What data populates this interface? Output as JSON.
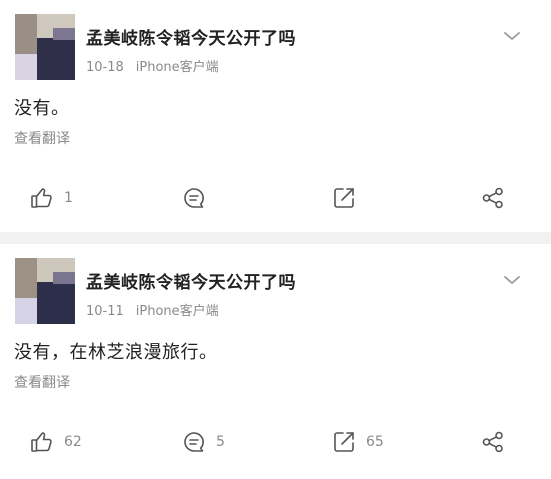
{
  "posts": [
    {
      "author": "孟美岐陈令韬今天公开了吗",
      "date": "10-18",
      "source": "iPhone客户端",
      "content": "没有。",
      "translate_label": "查看翻译",
      "likes": "1",
      "comments": "",
      "forwards": "",
      "avatar_colors": [
        "#cfc8bd",
        "#9a8f84",
        "#2f2f4a",
        "#d8d4e4",
        "#7d7690"
      ]
    },
    {
      "author": "孟美岐陈令韬今天公开了吗",
      "date": "10-11",
      "source": "iPhone客户端",
      "content": "没有，在林芝浪漫旅行。",
      "translate_label": "查看翻译",
      "likes": "62",
      "comments": "5",
      "forwards": "65",
      "avatar_colors": [
        "#cdc7bc",
        "#9c9184",
        "#2d2e4a",
        "#d7d3e6",
        "#7b7690"
      ]
    }
  ],
  "icons": [
    "chevron-down-icon",
    "like-icon",
    "comment-icon",
    "forward-icon",
    "share-icon"
  ],
  "colors": {
    "text": "#222222",
    "meta": "#8a8a8a",
    "icon": "#555555",
    "separator": "#f2f2f2"
  }
}
